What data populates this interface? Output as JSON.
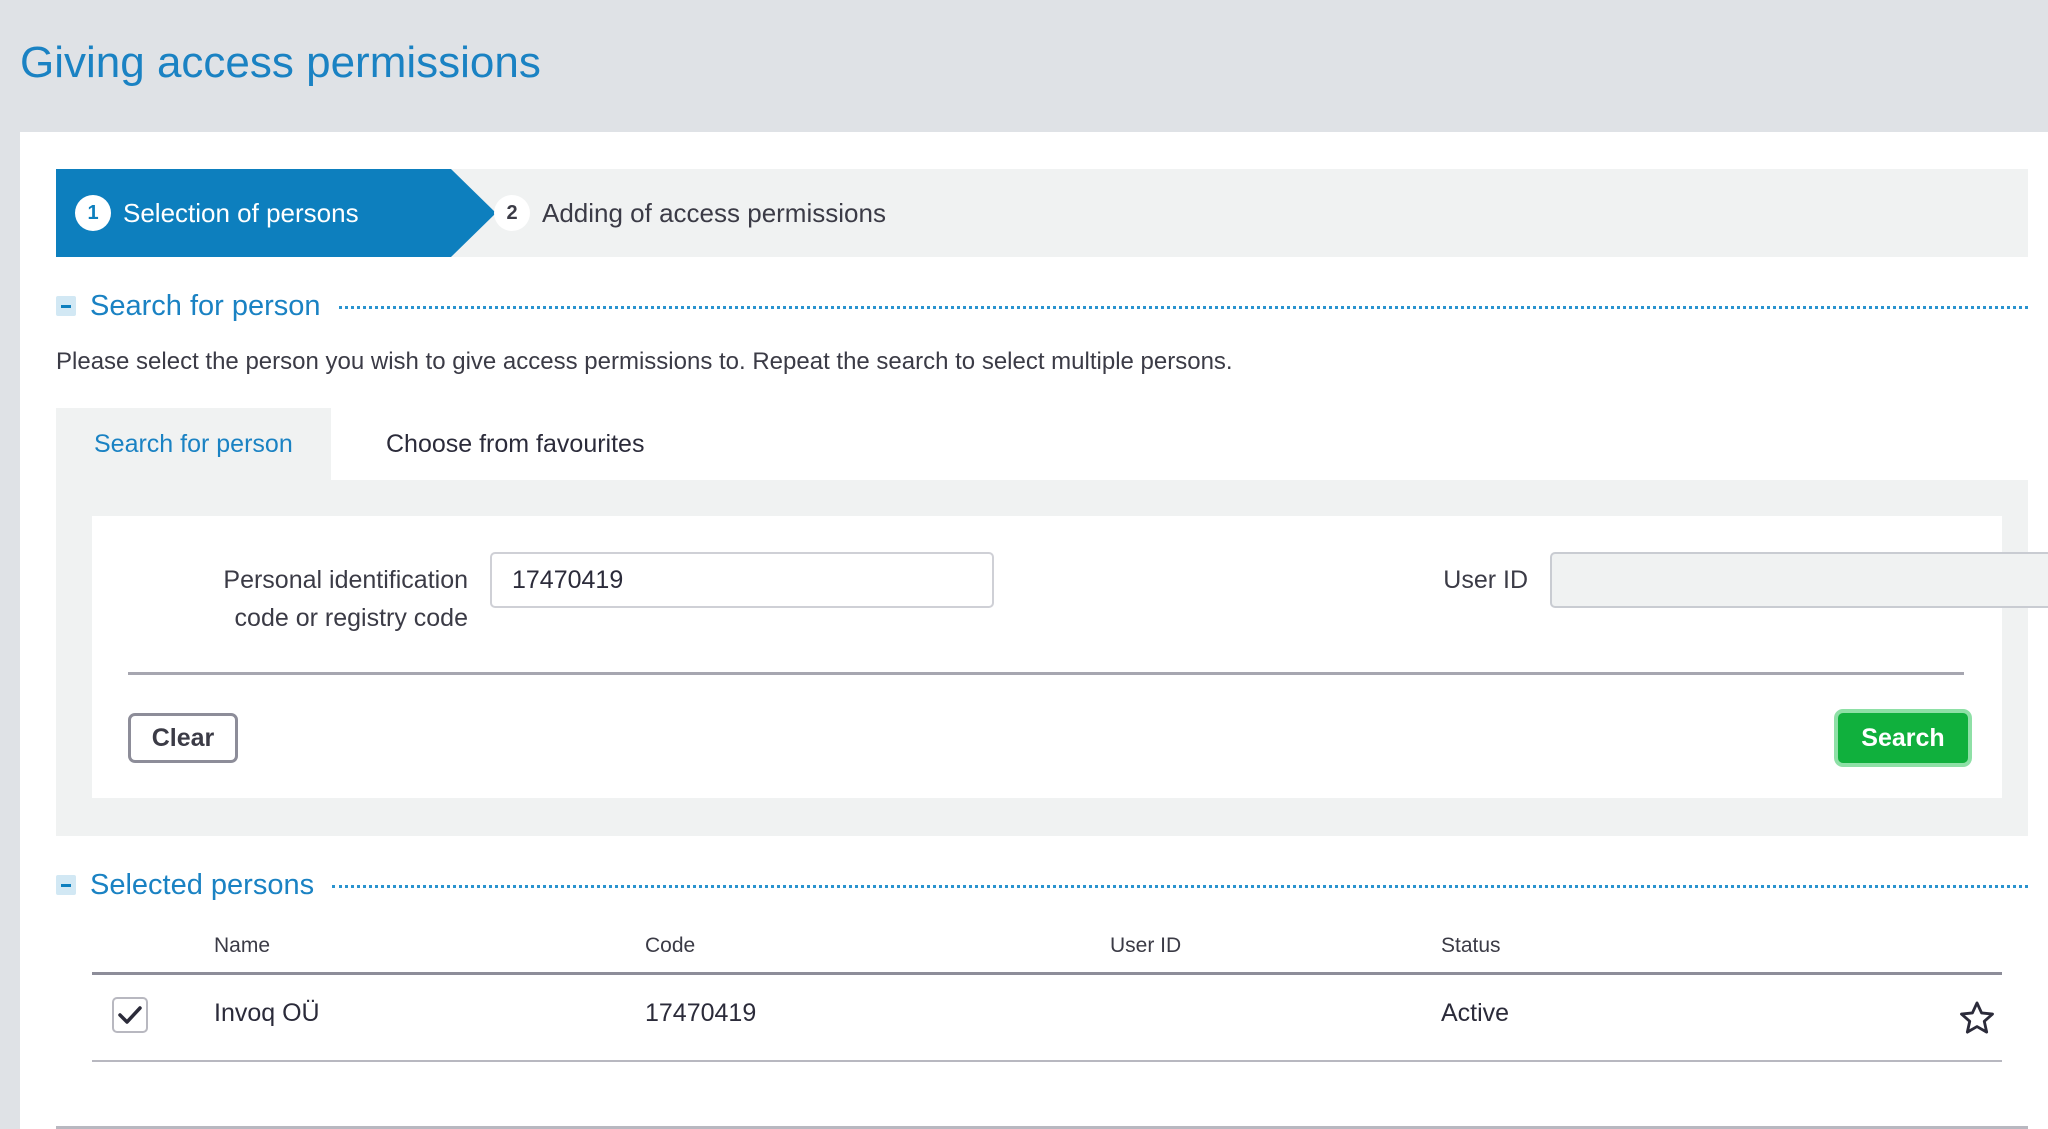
{
  "page": {
    "title": "Giving access permissions"
  },
  "stepper": {
    "steps": [
      {
        "number": "1",
        "label": "Selection of persons",
        "active": true
      },
      {
        "number": "2",
        "label": "Adding of access permissions",
        "active": false
      }
    ]
  },
  "search_section": {
    "title": "Search for person",
    "description": "Please select the person you wish to give access permissions to. Repeat the search to select multiple persons.",
    "tabs": [
      {
        "label": "Search for person",
        "active": true
      },
      {
        "label": "Choose from favourites",
        "active": false
      }
    ],
    "form": {
      "id_code_label_line1": "Personal identification",
      "id_code_label_line2": "code or registry code",
      "id_code_value": "17470419",
      "user_id_label": "User ID",
      "user_id_value": "",
      "clear_label": "Clear",
      "search_label": "Search"
    }
  },
  "selected_section": {
    "title": "Selected persons",
    "columns": {
      "name": "Name",
      "code": "Code",
      "user_id": "User ID",
      "status": "Status"
    },
    "rows": [
      {
        "checked": true,
        "name": "Invoq OÜ",
        "code": "17470419",
        "user_id": "",
        "status": "Active",
        "favourite": false
      }
    ]
  },
  "icons": {
    "collapse": "minus-icon",
    "check": "checkmark-icon",
    "favourite": "star-outline-icon"
  },
  "colors": {
    "accent": "#0d7fbe",
    "title": "#1a82c3",
    "search_button": "#10b03d"
  }
}
